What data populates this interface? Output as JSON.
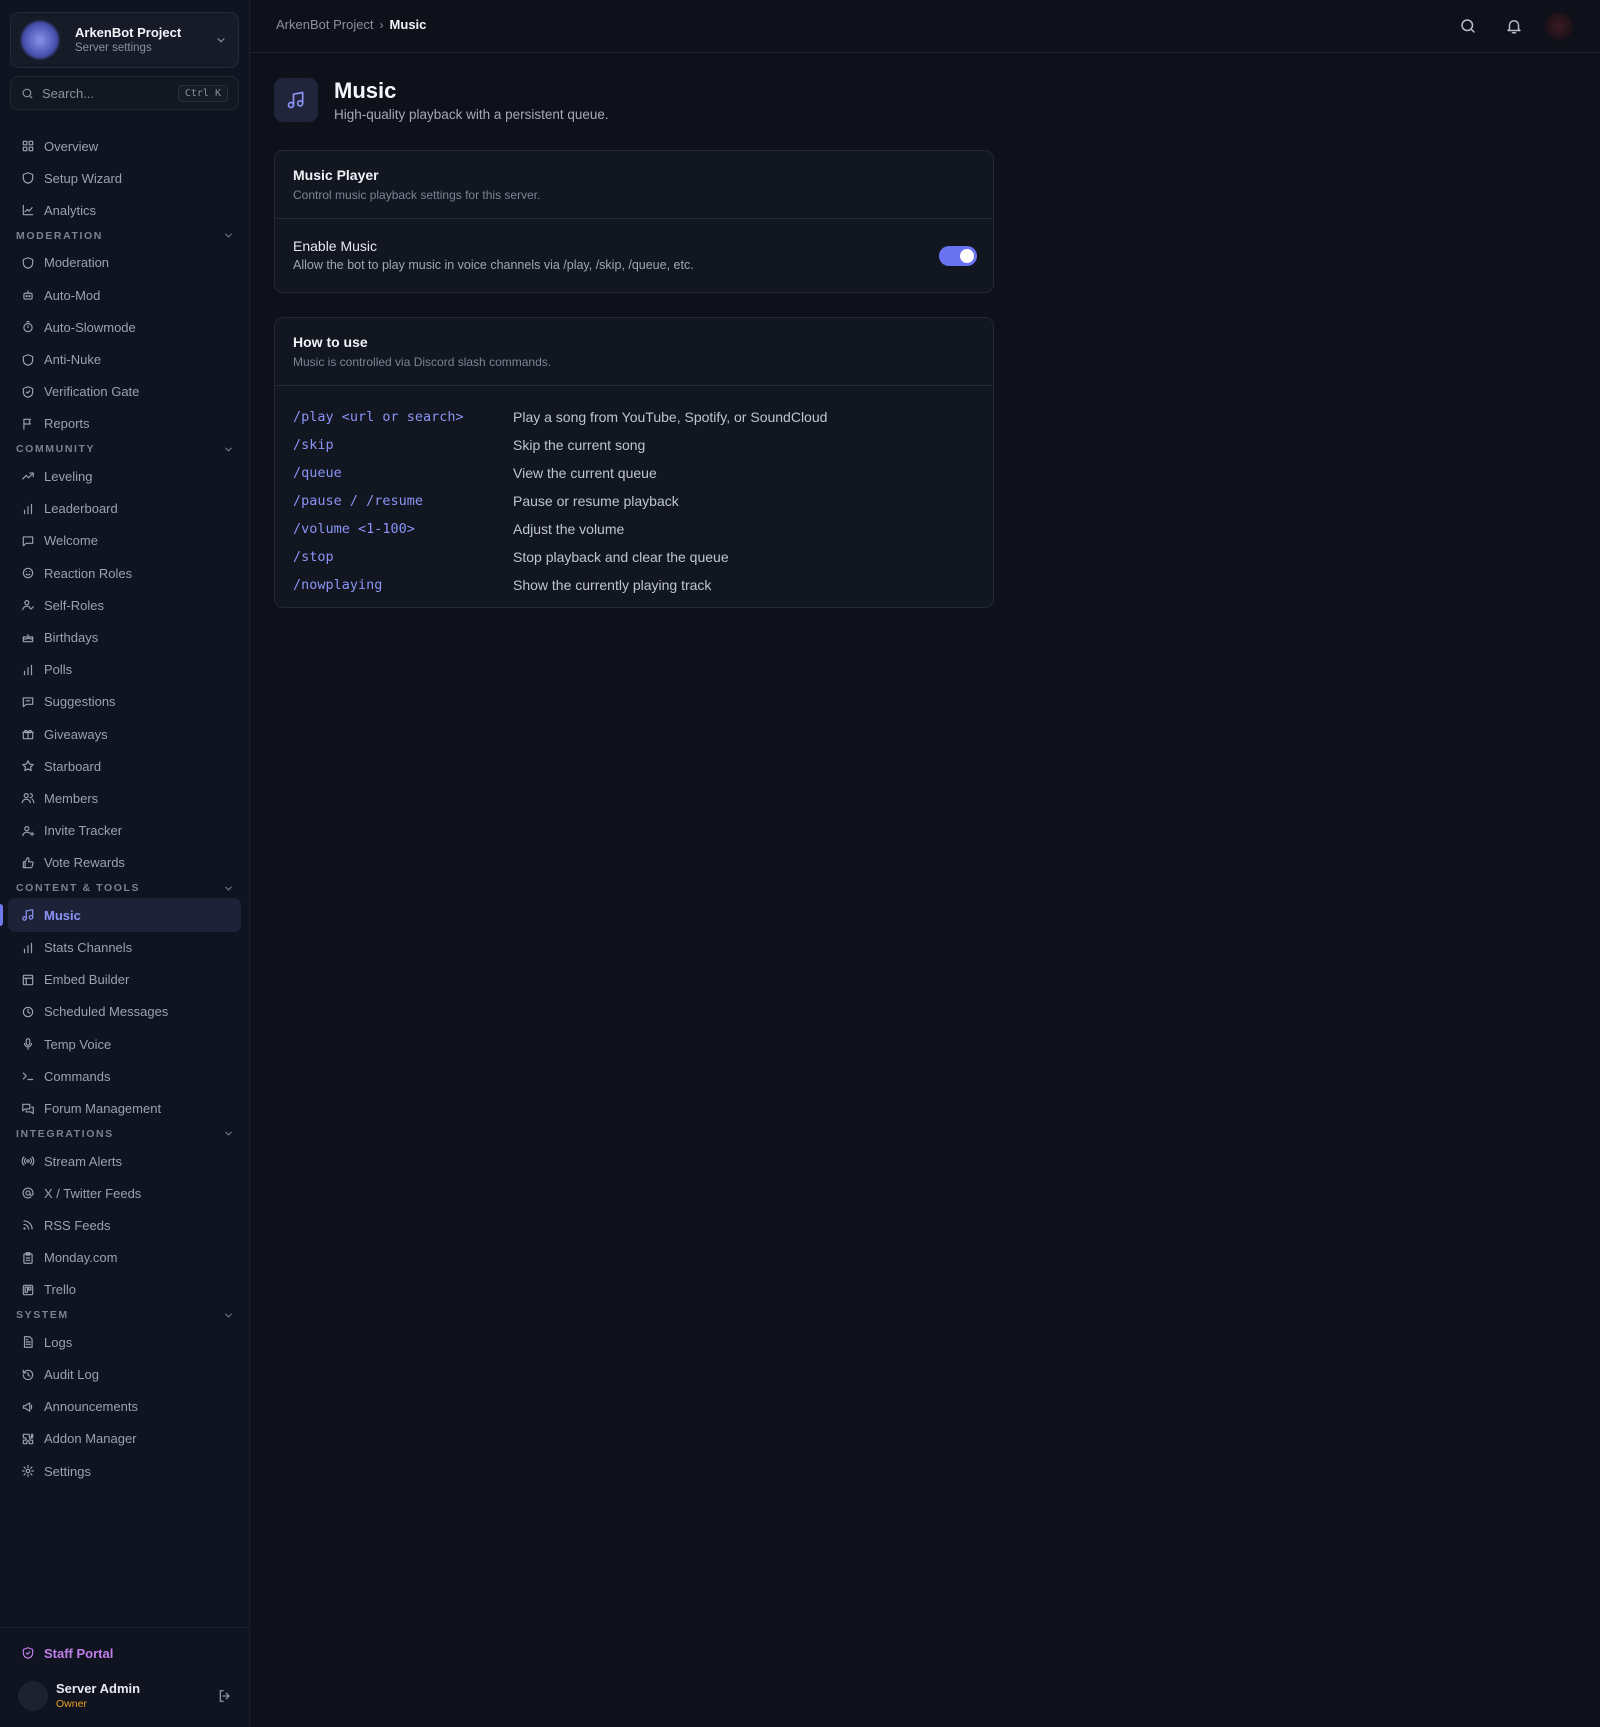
{
  "server": {
    "name": "ArkenBot Project",
    "subtitle": "Server settings"
  },
  "search": {
    "placeholder": "Search...",
    "shortcut": "Ctrl K"
  },
  "nav": {
    "top": [
      {
        "label": "Overview",
        "icon": "grid-icon"
      },
      {
        "label": "Setup Wizard",
        "icon": "shield-icon"
      },
      {
        "label": "Analytics",
        "icon": "chart-line-icon"
      }
    ],
    "sections": [
      {
        "title": "MODERATION",
        "items": [
          {
            "label": "Moderation",
            "icon": "shield-icon"
          },
          {
            "label": "Auto-Mod",
            "icon": "bot-icon"
          },
          {
            "label": "Auto-Slowmode",
            "icon": "timer-icon"
          },
          {
            "label": "Anti-Nuke",
            "icon": "shield-icon"
          },
          {
            "label": "Verification Gate",
            "icon": "shield-check-icon"
          },
          {
            "label": "Reports",
            "icon": "flag-icon"
          }
        ]
      },
      {
        "title": "COMMUNITY",
        "items": [
          {
            "label": "Leveling",
            "icon": "trending-up-icon"
          },
          {
            "label": "Leaderboard",
            "icon": "bar-chart-icon"
          },
          {
            "label": "Welcome",
            "icon": "message-icon"
          },
          {
            "label": "Reaction Roles",
            "icon": "smile-icon"
          },
          {
            "label": "Self-Roles",
            "icon": "user-check-icon"
          },
          {
            "label": "Birthdays",
            "icon": "cake-icon"
          },
          {
            "label": "Polls",
            "icon": "bar-chart-icon"
          },
          {
            "label": "Suggestions",
            "icon": "message-square-icon"
          },
          {
            "label": "Giveaways",
            "icon": "gift-icon"
          },
          {
            "label": "Starboard",
            "icon": "star-icon"
          },
          {
            "label": "Members",
            "icon": "users-icon"
          },
          {
            "label": "Invite Tracker",
            "icon": "user-plus-icon"
          },
          {
            "label": "Vote Rewards",
            "icon": "thumbs-up-icon"
          }
        ]
      },
      {
        "title": "CONTENT & TOOLS",
        "items": [
          {
            "label": "Music",
            "icon": "music-icon",
            "active": true
          },
          {
            "label": "Stats Channels",
            "icon": "bar-chart-icon"
          },
          {
            "label": "Embed Builder",
            "icon": "layout-icon"
          },
          {
            "label": "Scheduled Messages",
            "icon": "clock-icon"
          },
          {
            "label": "Temp Voice",
            "icon": "mic-icon"
          },
          {
            "label": "Commands",
            "icon": "terminal-icon"
          },
          {
            "label": "Forum Management",
            "icon": "messages-icon"
          }
        ]
      },
      {
        "title": "INTEGRATIONS",
        "items": [
          {
            "label": "Stream Alerts",
            "icon": "radio-icon"
          },
          {
            "label": "X / Twitter Feeds",
            "icon": "at-sign-icon"
          },
          {
            "label": "RSS Feeds",
            "icon": "rss-icon"
          },
          {
            "label": "Monday.com",
            "icon": "clipboard-icon"
          },
          {
            "label": "Trello",
            "icon": "trello-icon"
          }
        ]
      },
      {
        "title": "SYSTEM",
        "items": [
          {
            "label": "Logs",
            "icon": "file-text-icon"
          },
          {
            "label": "Audit Log",
            "icon": "history-icon"
          },
          {
            "label": "Announcements",
            "icon": "megaphone-icon"
          },
          {
            "label": "Addon Manager",
            "icon": "puzzle-icon"
          },
          {
            "label": "Settings",
            "icon": "gear-icon"
          }
        ]
      }
    ]
  },
  "footer": {
    "staff_portal": "Staff Portal",
    "user_name": "Server Admin",
    "user_role": "Owner"
  },
  "breadcrumb": {
    "parent": "ArkenBot Project",
    "separator": "›",
    "current": "Music"
  },
  "page": {
    "title": "Music",
    "subtitle": "High-quality playback with a persistent queue."
  },
  "player_card": {
    "title": "Music Player",
    "description": "Control music playback settings for this server.",
    "setting_title": "Enable Music",
    "setting_desc": "Allow the bot to play music in voice channels via /play, /skip, /queue, etc.",
    "enabled": true
  },
  "howto_card": {
    "title": "How to use",
    "description": "Music is controlled via Discord slash commands.",
    "commands": [
      {
        "cmd": "/play <url or search>",
        "desc": "Play a song from YouTube, Spotify, or SoundCloud"
      },
      {
        "cmd": "/skip",
        "desc": "Skip the current song"
      },
      {
        "cmd": "/queue",
        "desc": "View the current queue"
      },
      {
        "cmd": "/pause / /resume",
        "desc": "Pause or resume playback"
      },
      {
        "cmd": "/volume <1-100>",
        "desc": "Adjust the volume"
      },
      {
        "cmd": "/stop",
        "desc": "Stop playback and clear the queue"
      },
      {
        "cmd": "/nowplaying",
        "desc": "Show the currently playing track"
      }
    ]
  },
  "colors": {
    "accent": "#7078ee",
    "owner": "#e8a020",
    "staff": "#c07ee8"
  }
}
